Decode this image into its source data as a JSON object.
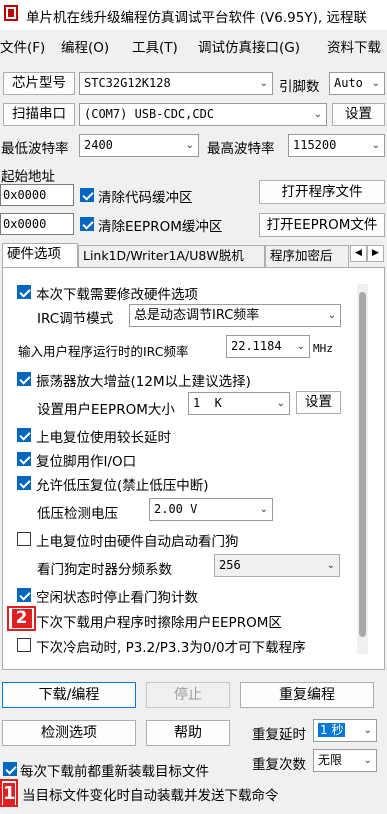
{
  "window": {
    "title": "单片机在线升级编程仿真调试平台软件 (V6.95Y), 远程联"
  },
  "menu": [
    "文件(F)",
    "编程(O)",
    "工具(T)",
    "调试仿真接口(G)",
    "资料下载"
  ],
  "chip": {
    "label": "芯片型号",
    "value": "STC32G12K128",
    "pins_label": "引脚数",
    "pins_value": "Auto"
  },
  "port": {
    "scan_label": "扫描串口",
    "value": "(COM7) USB-CDC,CDC",
    "settings_label": "设置"
  },
  "baud": {
    "min_label": "最低波特率",
    "min_value": "2400",
    "max_label": "最高波特率",
    "max_value": "115200"
  },
  "start_address": {
    "label": "起始地址",
    "code_addr": "0x0000",
    "clear_code_label": "清除代码缓冲区",
    "open_program_label": "打开程序文件",
    "eeprom_addr": "0x0000",
    "clear_eeprom_label": "清除EEPROM缓冲区",
    "open_eeprom_label": "打开EEPROM文件"
  },
  "tabs": [
    "硬件选项",
    "Link1D/Writer1A/U8W脱机",
    "程序加密后"
  ],
  "options": {
    "modify_hw": "本次下载需要修改硬件选项",
    "irc_mode_label": "IRC调节模式",
    "irc_mode_value": "总是动态调节IRC频率",
    "irc_freq_label": "输入用户程序运行时的IRC频率",
    "irc_freq_value": "22.1184",
    "irc_freq_unit": "MHz",
    "osc_gain": "振荡器放大增益(12M以上建议选择)",
    "eeprom_size_label": "设置用户EEPROM大小",
    "eeprom_size_value": "1  K",
    "eeprom_set_label": "设置",
    "long_reset": "上电复位使用较长延时",
    "reset_io": "复位脚用作I/O口",
    "lvr": "允许低压复位(禁止低压中断)",
    "lvd_label": "低压检测电压",
    "lvd_value": "2.00 V",
    "wdt_auto": "上电复位时由硬件自动启动看门狗",
    "wdt_div_label": "看门狗定时器分频系数",
    "wdt_div_value": "256",
    "idle_wdt": "空闲状态时停止看门狗计数",
    "erase_eeprom": "下次下载用户程序时擦除用户EEPROM区",
    "p32p33": "下次冷启动时, P3.2/P3.3为0/0才可下载程序"
  },
  "actions": {
    "download": "下载/编程",
    "stop": "停止",
    "repeat": "重复编程",
    "detect": "检测选项",
    "help": "帮助",
    "repeat_delay_label": "重复延时",
    "repeat_delay_value": "1 秒",
    "repeat_count_label": "重复次数",
    "repeat_count_value": "无限"
  },
  "footer": {
    "reload": "每次下载前都重新装载目标文件",
    "auto_send": "当目标文件变化时自动装载并发送下载命令"
  },
  "badges": {
    "badge_2": "2",
    "badge_1": "1"
  }
}
